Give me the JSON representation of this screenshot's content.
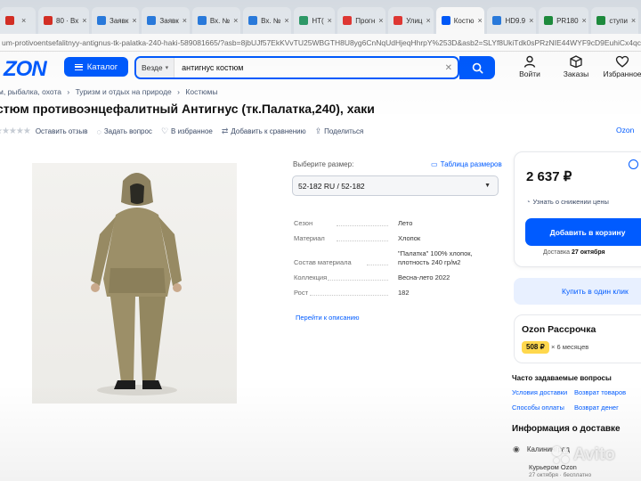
{
  "browser": {
    "tabs": [
      {
        "label": "",
        "icon": "gmail-icon",
        "color": "#d93025",
        "active": false
      },
      {
        "label": "80 · Вх",
        "icon": "gmail-icon",
        "color": "#d93025",
        "active": false
      },
      {
        "label": "Заявк",
        "icon": "doc-icon",
        "color": "#2a7de1",
        "active": false
      },
      {
        "label": "Заявк",
        "icon": "doc-icon",
        "color": "#2a7de1",
        "active": false
      },
      {
        "label": "Вх. №",
        "icon": "doc-icon",
        "color": "#2a7de1",
        "active": false
      },
      {
        "label": "Вх. №",
        "icon": "doc-icon",
        "color": "#2a7de1",
        "active": false
      },
      {
        "label": "НТ(",
        "icon": "page-icon",
        "color": "#2f9d6a",
        "active": false
      },
      {
        "label": "Прогн",
        "icon": "weather-icon",
        "color": "#e53935",
        "active": false
      },
      {
        "label": "Улиц",
        "icon": "map-pin-icon",
        "color": "#e53935",
        "active": false
      },
      {
        "label": "Костю",
        "icon": "ozon-icon",
        "color": "#005bff",
        "active": true
      },
      {
        "label": "HD9.9",
        "icon": "globe-icon",
        "color": "#2a7de1",
        "active": false
      },
      {
        "label": "PR180",
        "icon": "sheet-icon",
        "color": "#1e8e3e",
        "active": false
      },
      {
        "label": "ступи",
        "icon": "sheet-icon",
        "color": "#1e8e3e",
        "active": false
      }
    ],
    "url": "um-protivoentsefalitnyy-antignus-tk-palatka-240-haki-589081665/?asb=8jbUJf57EkKVvTU25WBGTH8U8yg6CnNqUdHjeqHhrpY%253D&asb2=SLYf8UkiTdk0sPRzNIE44WYF9cD9EuhiCx4qcF3Kn_ki6UYqwlotBVYg"
  },
  "header": {
    "logo": "ZON",
    "catalog_label": "Каталог",
    "search_scope": "Везде",
    "search_query": "антигнус костюм",
    "nav": [
      {
        "label": "Войти",
        "icon": "user-icon"
      },
      {
        "label": "Заказы",
        "icon": "box-icon"
      },
      {
        "label": "Избранное",
        "icon": "heart-icon"
      }
    ]
  },
  "breadcrumb": [
    "м, рыбалка, охота",
    "›",
    "Туризм и отдых на природе",
    "›",
    "Костюмы"
  ],
  "product": {
    "title": "стюм противоэнцефалитный Антигнус (тк.Палатка,240), хаки",
    "actions": [
      {
        "label": "Оставить отзыв",
        "icon": "none"
      },
      {
        "label": "Задать вопрос",
        "icon": "question-icon"
      },
      {
        "label": "В избранное",
        "icon": "heart-icon"
      },
      {
        "label": "Добавить к сравнению",
        "icon": "compare-icon"
      },
      {
        "label": "Поделиться",
        "icon": "share-icon"
      }
    ],
    "seller_label": "Ozon",
    "size_label": "Выберите размер:",
    "size_table": "Таблица размеров",
    "size_value": "52-182 RU / 52-182",
    "specs": [
      {
        "key": "Сезон",
        "value": "Лето"
      },
      {
        "key": "Материал",
        "value": "Хлопок"
      },
      {
        "key": "Состав материала",
        "value": "\"Палатка\" 100% хлопок, плотность 240 гр/м2"
      },
      {
        "key": "Коллекция",
        "value": "Весна-лето 2022"
      },
      {
        "key": "Рост",
        "value": "182"
      }
    ],
    "description_link": "Перейти к описанию"
  },
  "buy": {
    "price": "2 637 ₽",
    "price_alert": "Узнать о снижении цены",
    "cart_button": "Добавить в корзину",
    "delivery_prefix": "Доставка",
    "delivery_date": "27 октября",
    "one_click": "Купить в один клик"
  },
  "installments": {
    "title": "Ozon Рассрочка",
    "amount": "508 ₽",
    "term": "× 6 месяцев"
  },
  "faq": {
    "title": "Часто задаваемые вопросы",
    "links": [
      "Условия доставки",
      "Возврат товаров",
      "Способы оплаты",
      "Возврат денег"
    ]
  },
  "delivery_info": {
    "title": "Информация о доставке",
    "location": "Калининград",
    "courier": "Курьером Ozon",
    "courier_date": "27 октября · бесплатно"
  },
  "watermark": "Avito"
}
